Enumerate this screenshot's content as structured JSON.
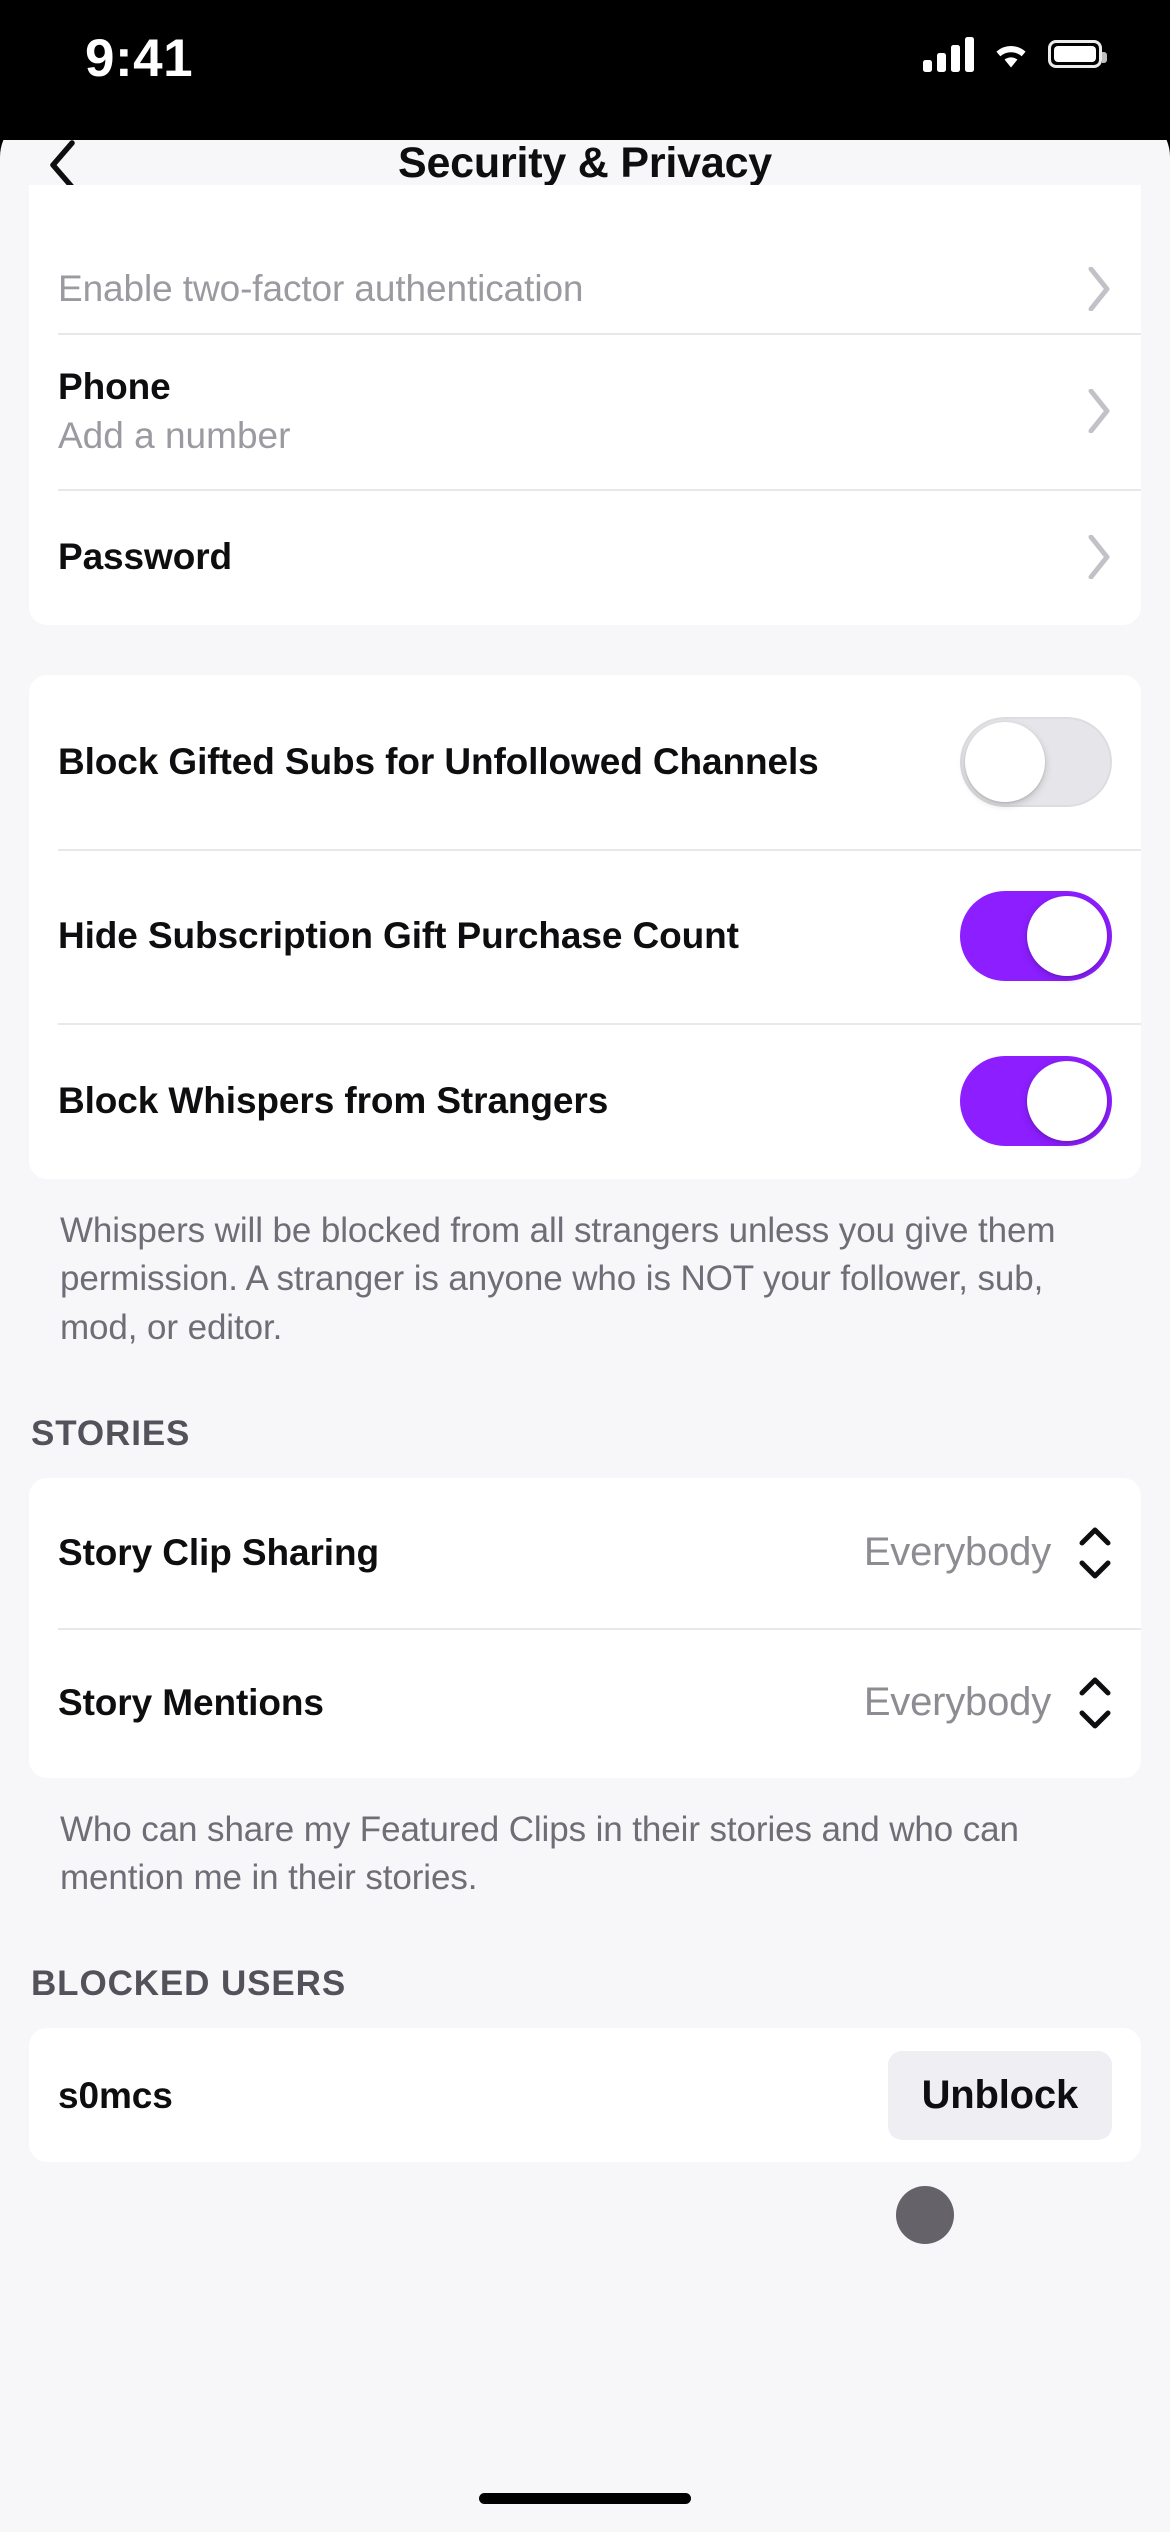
{
  "statusbar": {
    "time": "9:41",
    "icons": [
      "cellular-signal-icon",
      "wifi-icon",
      "battery-icon"
    ]
  },
  "nav": {
    "back_icon": "chevron-left-icon",
    "title": "Security & Privacy"
  },
  "colors": {
    "accent_purple": "#8C1EFF",
    "page_background": "#F7F6F9",
    "card_background": "#FFFFFF",
    "primary_text": "#0E0E10",
    "muted_text": "#9B9AA0",
    "footnote_text": "#6F6E77",
    "toggle_off": "#E6E5E9",
    "unblock_button_bg": "#EFEEF2",
    "touch_indicator": "#3C3A40"
  },
  "account_card": {
    "rows": [
      {
        "title": "Enable two-factor authentication",
        "style": "muted",
        "accessory": "chevron-right-icon",
        "clipped": true
      },
      {
        "title": "Phone",
        "subtitle": "Add a number",
        "style": "normal",
        "accessory": "chevron-right-icon"
      },
      {
        "title": "Password",
        "style": "normal",
        "accessory": "chevron-right-icon"
      }
    ]
  },
  "privacy_toggles": {
    "rows": [
      {
        "title": "Block Gifted Subs for Unfollowed Channels",
        "accessory": "toggle-switch",
        "value": false
      },
      {
        "title": "Hide Subscription Gift Purchase Count",
        "accessory": "toggle-switch",
        "value": true
      },
      {
        "title": "Block Whispers from Strangers",
        "accessory": "toggle-switch",
        "value": true
      }
    ],
    "footnote": "Whispers will be blocked from all strangers unless you give them permission. A stranger is anyone who is NOT your follower, sub, mod, or editor."
  },
  "stories": {
    "header": "STORIES",
    "rows": [
      {
        "title": "Story Clip Sharing",
        "value": "Everybody",
        "accessory": "up-down-stepper-icon"
      },
      {
        "title": "Story Mentions",
        "value": "Everybody",
        "accessory": "up-down-stepper-icon"
      }
    ],
    "footnote": "Who can share my Featured Clips in their stories and who can mention me in their stories."
  },
  "blocked_users": {
    "header": "BLOCKED USERS",
    "rows": [
      {
        "username": "s0mcs",
        "action_label": "Unblock"
      }
    ]
  },
  "home_indicator": "home-indicator"
}
